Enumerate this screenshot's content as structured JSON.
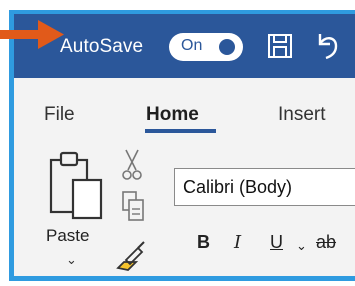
{
  "titlebar": {
    "autosave_label": "AutoSave",
    "toggle_state": "On",
    "save_icon": "save-icon",
    "undo_icon": "undo-icon"
  },
  "tabs": [
    {
      "label": "File",
      "active": false
    },
    {
      "label": "Home",
      "active": true
    },
    {
      "label": "Insert",
      "active": false
    }
  ],
  "clipboard": {
    "paste_label": "Paste",
    "icons": [
      "paste-icon",
      "cut-icon",
      "copy-icon",
      "format-painter-icon"
    ]
  },
  "font": {
    "name": "Calibri (Body)",
    "bold": "B",
    "italic": "I",
    "underline": "U",
    "strike": "ab"
  },
  "colors": {
    "titlebar": "#2b579a",
    "frame_outline": "#2f9be0",
    "annotation_arrow": "#e15a1a",
    "ribbon_bg": "#f3f3f3"
  }
}
